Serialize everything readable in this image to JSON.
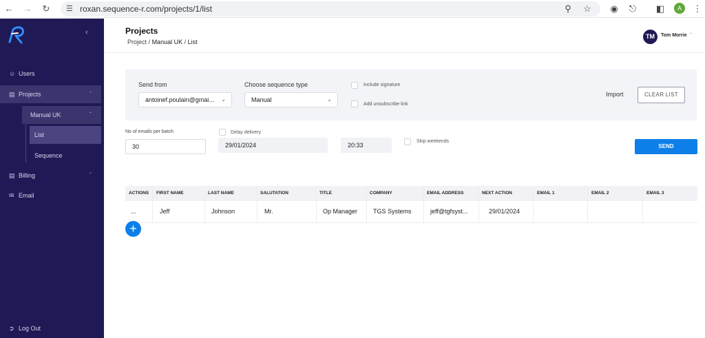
{
  "browser": {
    "url": "roxan.sequence-r.com/projects/1/list",
    "avatar_letter": "A"
  },
  "sidebar": {
    "items": [
      {
        "label": "Users",
        "icon": "user-icon"
      },
      {
        "label": "Projects",
        "icon": "folder-icon"
      },
      {
        "label": "Manual UK"
      },
      {
        "label": "List"
      },
      {
        "label": "Sequence"
      },
      {
        "label": "Billing",
        "icon": "billing-icon"
      },
      {
        "label": "Email",
        "icon": "mail-icon"
      }
    ],
    "logout": "Log Out",
    "collapse_icon": "chevron-left-icon",
    "bg_color": "#1f1a55"
  },
  "header": {
    "title": "Projects",
    "breadcrumb": [
      "Project",
      "Manual UK",
      "List"
    ],
    "breadcrumb_sep": "/",
    "user_initials": "TM",
    "user_name": "Tom Morrie"
  },
  "send_panel": {
    "send_from_label": "Send from",
    "send_from_value": "antoinef.poulain@gmai...",
    "sequence_type_label": "Choose sequence type",
    "sequence_type_value": "Manual",
    "include_signature_label": "Include signature",
    "unsubscribe_label": "Add unsubscribe link",
    "import_label": "Import",
    "clear_list_label": "CLEAR LIST"
  },
  "batch": {
    "emails_per_batch_label": "No of emails per batch",
    "emails_per_batch_value": "30",
    "delay_delivery_label": "Delay delivery",
    "date_value": "29/01/2024",
    "time_value": "20:33",
    "skip_weekends_label": "Skip weekends",
    "send_label": "SEND",
    "accent_color": "#0d7fe9"
  },
  "table": {
    "columns": [
      "ACTIONS",
      "FIRST NAME",
      "LAST NAME",
      "SALUTATION",
      "TITLE",
      "COMPANY",
      "EMAIL ADDRESS",
      "NEXT ACTION",
      "EMAIL 1",
      "EMAIL 2",
      "EMAIL 3"
    ],
    "rows": [
      [
        "...",
        "Jeff",
        "Johnson",
        "Mr.",
        "Op Manager",
        "TGS Systems",
        "jeff@tgfsyst...",
        "29/01/2024",
        "",
        "",
        ""
      ]
    ],
    "add_icon": "plus-icon"
  }
}
